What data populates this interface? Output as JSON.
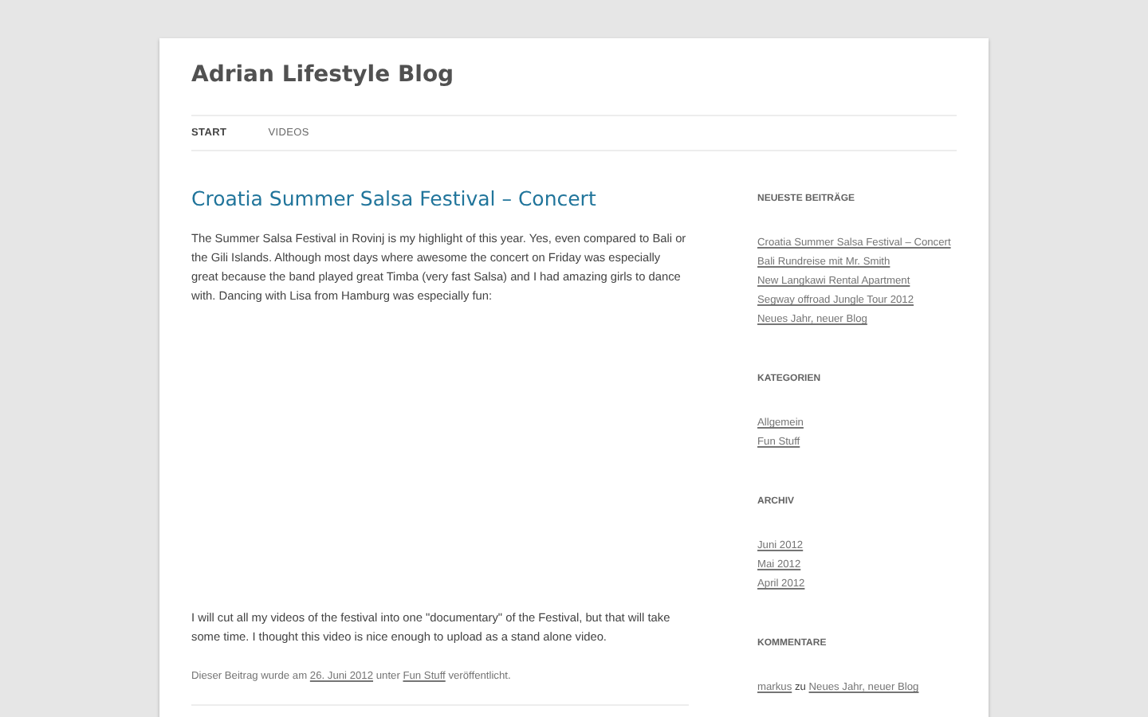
{
  "site_title": "Adrian Lifestyle Blog",
  "nav": [
    {
      "label": "START",
      "selected": true
    },
    {
      "label": "VIDEOS",
      "selected": false
    }
  ],
  "post": {
    "title": "Croatia Summer Salsa Festival – Concert",
    "paragraphs": [
      "The Summer Salsa Festival in Rovinj is my highlight of this year. Yes, even compared to Bali or the Gili Islands. Although most days where awesome the concert on Friday was especially great because the band played great Timba (very fast Salsa) and I had amazing girls to dance with. Dancing with Lisa from Hamburg was especially fun:",
      "I will cut all my videos of the festival into one \"documentary\" of the Festival, but that will take some time. I thought this video is nice enough to upload as a stand alone video."
    ],
    "meta": {
      "before": "Dieser Beitrag wurde am",
      "date": "26. Juni 2012",
      "middle": "unter",
      "category": "Fun Stuff",
      "after": "veröffentlicht."
    }
  },
  "sidebar": [
    {
      "heading": "NEUESTE BEITRÄGE",
      "kind": "links",
      "items": [
        "Croatia Summer Salsa Festival – Concert",
        "Bali Rundreise mit Mr. Smith",
        "New Langkawi Rental Apartment",
        "Segway offroad Jungle Tour 2012",
        "Neues Jahr, neuer Blog"
      ]
    },
    {
      "heading": "KATEGORIEN",
      "kind": "links",
      "items": [
        "Allgemein",
        "Fun Stuff"
      ]
    },
    {
      "heading": "ARCHIV",
      "kind": "links",
      "items": [
        "Juni 2012",
        "Mai 2012",
        "April 2012"
      ]
    },
    {
      "heading": "KOMMENTARE",
      "kind": "comments",
      "comments": [
        {
          "author": "markus",
          "joiner": "zu",
          "post": "Neues Jahr, neuer Blog"
        }
      ]
    }
  ]
}
